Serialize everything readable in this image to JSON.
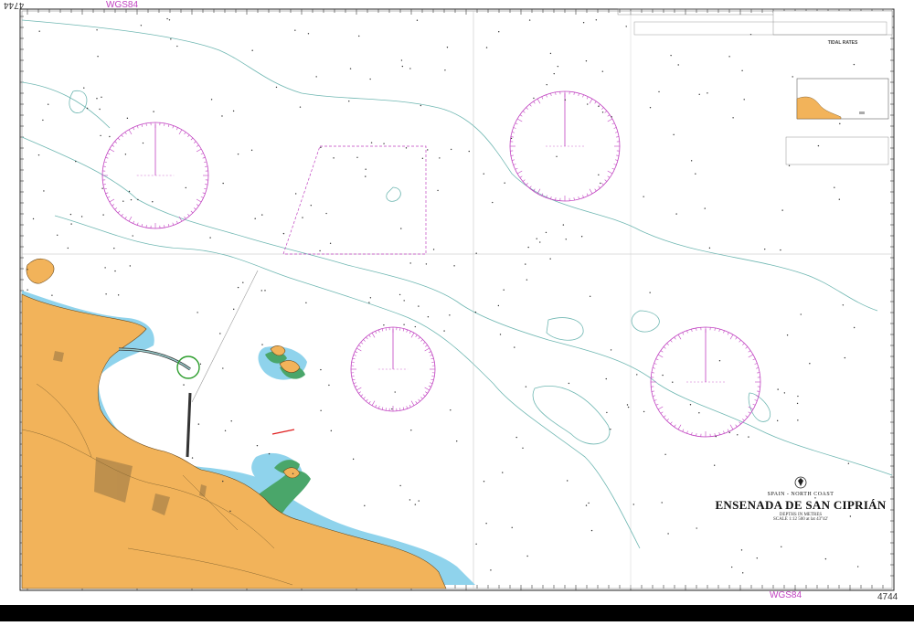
{
  "chart": {
    "number": "4744",
    "datum": "WGS84",
    "title": "ENSENADA DE SAN CIPRIÁN",
    "region": "SPAIN - NORTH COAST",
    "subtitle": "DEPTHS IN METRES",
    "scale_note": "SCALE 1:12 500 at lat 43°42'",
    "tidal_title": "TIDAL RATES"
  },
  "colors": {
    "land": "#f2b35a",
    "shallow": "#8fd3ec",
    "intertidal": "#4aa66a",
    "water": "#ffffff",
    "compass": "#c040c0",
    "depth_contour": "#6fb7b2",
    "grid": "#b0b0b0"
  },
  "features": {
    "compass_roses": 4,
    "port_marker": "green-circle",
    "ferry_line": "red"
  }
}
